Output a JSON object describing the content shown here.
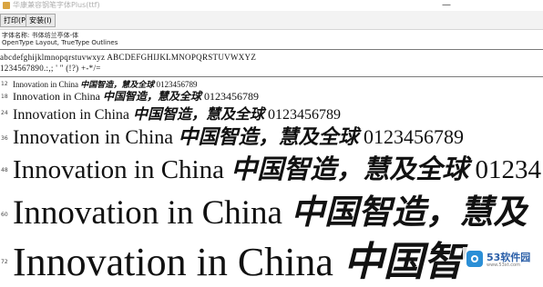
{
  "window": {
    "title": "华康兼容钢笔字体Plus(ttf)",
    "minimize_glyph": "—"
  },
  "toolbar": {
    "print_label": "打印(P)",
    "install_label": "安装(I)"
  },
  "info": {
    "font_name": "字体名称: 书体坊兰亭体-体",
    "font_type": "OpenType Layout, TrueType Outlines"
  },
  "charset": {
    "line1": "abcdefghijklmnopqrstuvwxyz ABCDEFGHIJKLMNOPQRSTUVWXYZ",
    "line2": "1234567890.:,; ' \" (!?) +-*/="
  },
  "samples": [
    {
      "size": "12",
      "latin": "Innovation in China",
      "cjk": "中国智造，慧及全球",
      "digits": "0123456789"
    },
    {
      "size": "18",
      "latin": "Innovation in China",
      "cjk": "中国智造，慧及全球",
      "digits": "0123456789"
    },
    {
      "size": "24",
      "latin": "Innovation in China",
      "cjk": "中国智造，慧及全球",
      "digits": "0123456789"
    },
    {
      "size": "36",
      "latin": "Innovation in China",
      "cjk": "中国智造，慧及全球",
      "digits": "0123456789"
    },
    {
      "size": "48",
      "latin": "Innovation in China",
      "cjk": "中国智造，慧及全球",
      "digits": "01234"
    },
    {
      "size": "60",
      "latin": "Innovation in China",
      "cjk": "中国智造，慧及",
      "digits": ""
    },
    {
      "size": "72",
      "latin": "Innovation in China",
      "cjk": "中国智",
      "digits": ""
    }
  ],
  "watermark": {
    "brand": "53软件园",
    "url": "www.53xt.com"
  }
}
